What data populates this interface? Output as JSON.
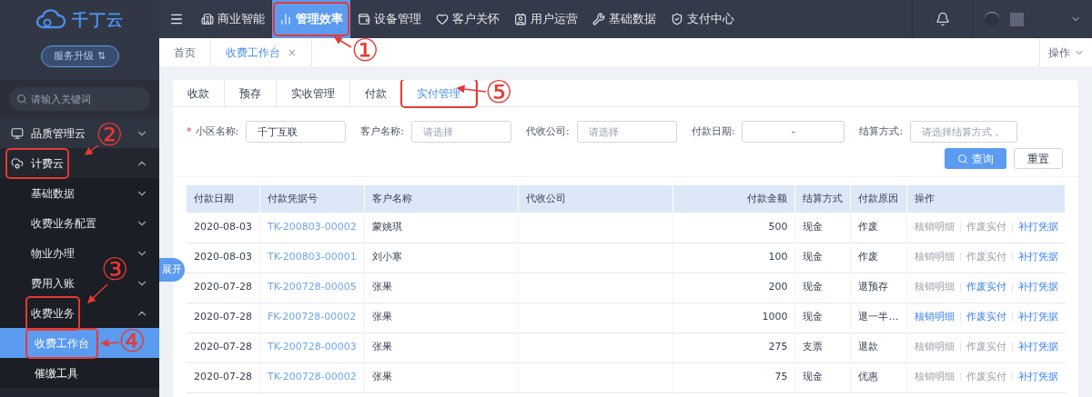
{
  "logo": {
    "text": "千丁云"
  },
  "upgrade_button": {
    "label": "服务升级 ⇅"
  },
  "top_nav": [
    {
      "label": "商业智能",
      "selected": false,
      "boxed": false
    },
    {
      "label": "管理效率",
      "selected": true,
      "boxed": true
    },
    {
      "label": "设备管理",
      "selected": false,
      "boxed": false
    },
    {
      "label": "客户关怀",
      "selected": false,
      "boxed": false
    },
    {
      "label": "用户运营",
      "selected": false,
      "boxed": false
    },
    {
      "label": "基础数据",
      "selected": false,
      "boxed": false
    },
    {
      "label": "支付中心",
      "selected": false,
      "boxed": false
    }
  ],
  "sidebar": {
    "search": {
      "placeholder": "请输入关键词"
    },
    "items": [
      {
        "label": "品质管理云",
        "expanded": false,
        "boxed": false
      },
      {
        "label": "计费云",
        "expanded": true,
        "boxed": true,
        "children": [
          {
            "label": "基础数据",
            "expanded": false,
            "boxed": false
          },
          {
            "label": "收费业务配置",
            "expanded": false,
            "boxed": false
          },
          {
            "label": "物业办理",
            "expanded": false,
            "boxed": false
          },
          {
            "label": "费用入账",
            "expanded": false,
            "boxed": false
          },
          {
            "label": "收费业务",
            "expanded": true,
            "boxed": true,
            "children": [
              {
                "label": "收费工作台",
                "selected": true,
                "boxed": true
              },
              {
                "label": "催缴工具",
                "selected": false,
                "boxed": false
              }
            ]
          }
        ]
      }
    ]
  },
  "page_tabs": [
    {
      "label": "首页",
      "selected": false,
      "closable": false
    },
    {
      "label": "收费工作台",
      "selected": true,
      "closable": true
    }
  ],
  "page_tab_close": "×",
  "operations_menu": "操作",
  "expand_handle": "展开",
  "tabs": [
    {
      "label": "收款",
      "selected": false,
      "boxed": false
    },
    {
      "label": "预存",
      "selected": false,
      "boxed": false
    },
    {
      "label": "实收管理",
      "selected": false,
      "boxed": false
    },
    {
      "label": "付款",
      "selected": false,
      "boxed": false
    },
    {
      "label": "实付管理",
      "selected": true,
      "boxed": true
    }
  ],
  "required_mark": "*",
  "filters": [
    {
      "label": "小区名称:",
      "required": true,
      "value": "千丁互联"
    },
    {
      "label": "客户名称:",
      "required": false,
      "placeholder": "请选择"
    },
    {
      "label": "代收公司:",
      "required": false,
      "placeholder": "请选择"
    },
    {
      "label": "付款日期:",
      "required": false,
      "kind": "range",
      "separator": "-"
    },
    {
      "label": "结算方式:",
      "required": false,
      "placeholder": "请选择结算方式，"
    }
  ],
  "buttons": {
    "search": "查询",
    "reset": "重置"
  },
  "table": {
    "columns": [
      "付款日期",
      "付款凭据号",
      "客户名称",
      "代收公司",
      "付款金额",
      "结算方式",
      "付款原因",
      "操作"
    ],
    "rows": [
      {
        "date": "2020-08-03",
        "voucher": "TK-200803-00002",
        "customer": "蒙姚琪",
        "amount": "500",
        "method": "现金",
        "reason": "作废",
        "actions": [
          {
            "label": "核销明细",
            "disabled": true
          },
          {
            "label": "作废实付",
            "disabled": true
          },
          {
            "label": "补打凭据",
            "disabled": false
          }
        ]
      },
      {
        "date": "2020-08-03",
        "voucher": "TK-200803-00001",
        "customer": "刘小寒",
        "amount": "100",
        "method": "现金",
        "reason": "作废",
        "actions": [
          {
            "label": "核销明细",
            "disabled": true
          },
          {
            "label": "作废实付",
            "disabled": true
          },
          {
            "label": "补打凭据",
            "disabled": false
          }
        ]
      },
      {
        "date": "2020-07-28",
        "voucher": "TK-200728-00005",
        "customer": "张果",
        "amount": "200",
        "method": "现金",
        "reason": "退预存",
        "actions": [
          {
            "label": "核销明细",
            "disabled": true
          },
          {
            "label": "作废实付",
            "disabled": false
          },
          {
            "label": "补打凭据",
            "disabled": false
          }
        ]
      },
      {
        "date": "2020-07-28",
        "voucher": "FK-200728-00002",
        "customer": "张果",
        "amount": "1000",
        "method": "现金",
        "reason": "退一半…",
        "actions": [
          {
            "label": "核销明细",
            "disabled": false
          },
          {
            "label": "作废实付",
            "disabled": false
          },
          {
            "label": "补打凭据",
            "disabled": false
          }
        ]
      },
      {
        "date": "2020-07-28",
        "voucher": "TK-200728-00003",
        "customer": "张果",
        "amount": "275",
        "method": "支票",
        "reason": "退款",
        "actions": [
          {
            "label": "核销明细",
            "disabled": true
          },
          {
            "label": "作废实付",
            "disabled": true
          },
          {
            "label": "补打凭据",
            "disabled": false
          }
        ]
      },
      {
        "date": "2020-07-28",
        "voucher": "TK-200728-00002",
        "customer": "张果",
        "amount": "75",
        "method": "现金",
        "reason": "优惠",
        "actions": [
          {
            "label": "核销明细",
            "disabled": true
          },
          {
            "label": "作废实付",
            "disabled": true
          },
          {
            "label": "补打凭据",
            "disabled": false
          }
        ]
      }
    ]
  },
  "callouts": [
    "①",
    "②",
    "③",
    "④",
    "⑤"
  ]
}
